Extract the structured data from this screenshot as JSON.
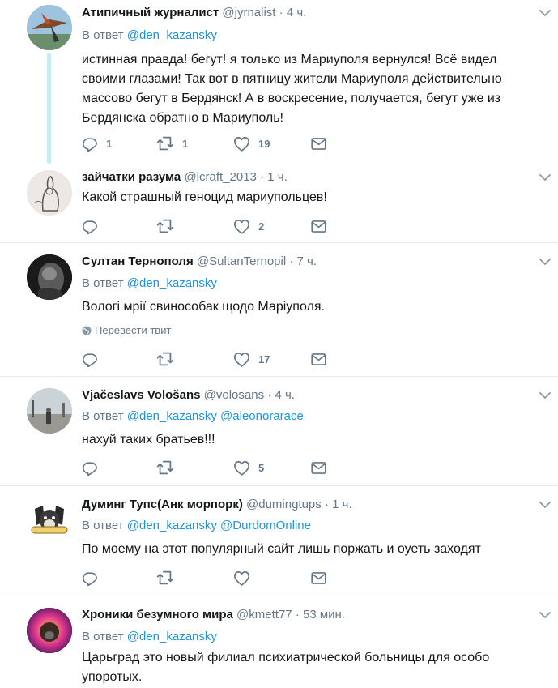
{
  "labels": {
    "reply_prefix": "В ответ",
    "translate": "Перевести твит"
  },
  "colors": {
    "link": "#1b95e0",
    "muted": "#657786",
    "thread": "#c6ecf7"
  },
  "tweets": [
    {
      "name": "Атипичный журналист",
      "handle": "@jyrnalist",
      "time": "4 ч.",
      "reply_to": [
        "@den_kazansky"
      ],
      "text": "истинная правда! бегут! я только из Мариуполя вернулся! Всё видел своими глазами! Так вот в пятницу жители Мариуполя действительно массово бегут в Бердянск! А в воскресение, получается, бегут уже из Бердянска обратно в Мариуполь!",
      "replies": "1",
      "retweets": "1",
      "likes": "19"
    },
    {
      "name": "зайчатки разума",
      "handle": "@icraft_2013",
      "time": "1 ч.",
      "text": "Какой страшный геноцид мариупольцев!",
      "replies": "",
      "retweets": "",
      "likes": "2"
    },
    {
      "name": "Султан Тернополя",
      "handle": "@SultanTernopil",
      "time": "7 ч.",
      "reply_to": [
        "@den_kazansky"
      ],
      "text": "Вологі мрії свинособак щодо Маріуполя.",
      "replies": "",
      "retweets": "",
      "likes": "17"
    },
    {
      "name": "Vjačeslavs Vološans",
      "handle": "@volosans",
      "time": "4 ч.",
      "reply_to": [
        "@den_kazansky",
        "@aleonorarace"
      ],
      "text": "нахуй таких братьев!!!",
      "replies": "",
      "retweets": "",
      "likes": "5"
    },
    {
      "name": "Думинг Тупс(Анк морпорк)",
      "handle": "@dumingtups",
      "time": "1 ч.",
      "reply_to": [
        "@den_kazansky",
        "@DurdomOnline"
      ],
      "text": "По моему на этот популярный сайт лишь поржать и оуеть заходят",
      "replies": "",
      "retweets": "",
      "likes": ""
    },
    {
      "name": "Хроники безумного мира",
      "handle": "@kmett77",
      "time": "53 мин.",
      "reply_to": [
        "@den_kazansky"
      ],
      "text": "Царьград это новый филиал психиатрической больницы для особо упоротых."
    }
  ]
}
